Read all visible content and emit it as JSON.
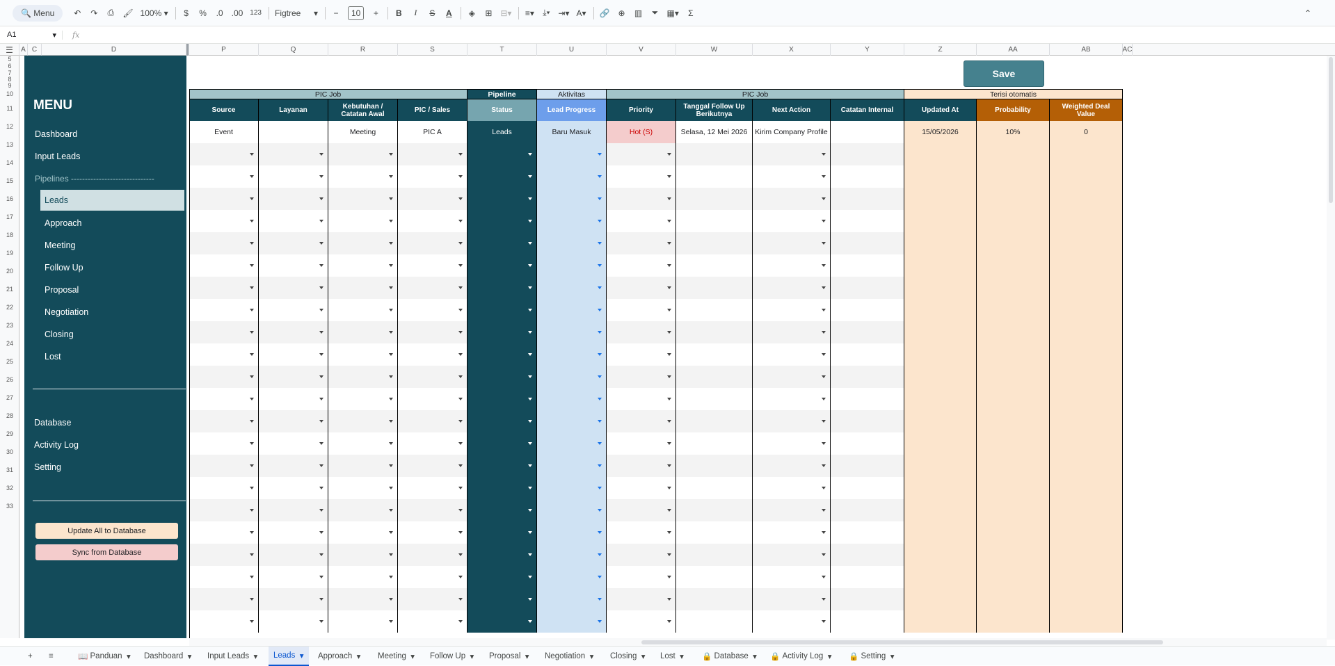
{
  "toolbar": {
    "menu": "Menu",
    "zoom": "100%",
    "currency": "$",
    "percent": "%",
    "dec_minus": ".0",
    "dec_plus": ".00",
    "format": "123",
    "font": "Figtree",
    "font_size": "10",
    "bold": "B",
    "italic": "I",
    "strike": "S",
    "text_color": "A",
    "sigma": "Σ"
  },
  "formula_bar": {
    "name_box": "A1",
    "fx": "fx"
  },
  "columns": [
    "A",
    "C",
    "D",
    "P",
    "Q",
    "R",
    "S",
    "T",
    "U",
    "V",
    "W",
    "X",
    "Y",
    "Z",
    "AA",
    "AB",
    "AC"
  ],
  "rows": [
    "5",
    "6",
    "7",
    "8",
    "9",
    "10",
    "11",
    "12",
    "13",
    "14",
    "15",
    "16",
    "17",
    "18",
    "19",
    "20",
    "21",
    "22",
    "23",
    "24",
    "25",
    "26",
    "27",
    "28",
    "29",
    "30",
    "31",
    "32",
    "33"
  ],
  "sidebar": {
    "title": "MENU",
    "items": [
      "Dashboard",
      "Input Leads"
    ],
    "pipelines_label": "Pipelines ------------------------------",
    "pipeline_items": [
      "Leads",
      "Approach",
      "Meeting",
      "Follow Up",
      "Proposal",
      "Negotiation",
      "Closing",
      "Lost"
    ],
    "bottom_items": [
      "Database",
      "Activity Log",
      "Setting"
    ],
    "btn_update": "Update All to Database",
    "btn_sync": "Sync from Database"
  },
  "save_label": "Save",
  "groups": [
    "PIC Job",
    "Pipeline",
    "Aktivitas",
    "PIC Job",
    "Terisi otomatis"
  ],
  "headers": [
    "Source",
    "Layanan",
    "Kebutuhan / Catatan Awal",
    "PIC / Sales",
    "Status",
    "Lead Progress",
    "Priority",
    "Tanggal Follow Up Berikutnya",
    "Next Action",
    "Catatan Internal",
    "Updated At",
    "Probability",
    "Weighted Deal Value"
  ],
  "row1": [
    "Event",
    "",
    "Meeting",
    "PIC A",
    "Leads",
    "Baru Masuk",
    "Hot (S)",
    "Selasa, 12 Mei 2026",
    "Kirim Company Profile",
    "",
    "15/05/2026",
    "10%",
    "0"
  ],
  "tabs": [
    "Panduan",
    "Dashboard",
    "Input Leads",
    "Leads",
    "Approach",
    "Meeting",
    "Follow Up",
    "Proposal",
    "Negotiation",
    "Closing",
    "Lost",
    "Database",
    "Activity Log",
    "Setting"
  ],
  "colors": {
    "teal": "#134b5a",
    "teal_mid": "#76a5af",
    "light_teal": "#a2c4c9",
    "blue_light": "#cfe2f3",
    "blue_header": "#6d9eeb",
    "orange": "#b45f06",
    "peach": "#fce5cd",
    "hot": "#f4cccc"
  }
}
